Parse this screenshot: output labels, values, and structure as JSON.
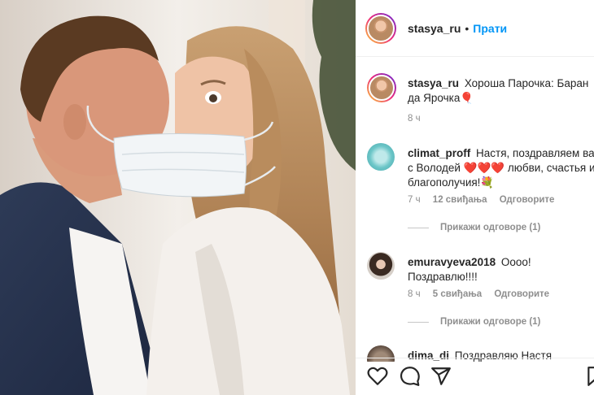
{
  "post": {
    "author": "stasya_ru",
    "dot": "•",
    "follow_label": "Прати",
    "caption_user": "stasya_ru",
    "caption_text": "Хороша Парочка: Баран да Ярочка🎈",
    "caption_time": "8 ч"
  },
  "comments": [
    {
      "user": "climat_proff",
      "text_before": "Настя, поздравляем вас с Володей ",
      "hearts": "❤️❤️❤️",
      "text_after": " любви, счастья и благополучия!💐",
      "time": "7 ч",
      "likes": "12 свиђања",
      "reply": "Одговорите",
      "view_replies": "Прикажи одговоре (1)"
    },
    {
      "user": "emuravyeva2018",
      "text": "Оооо! Поздравлю!!!!",
      "time": "8 ч",
      "likes": "5 свиђања",
      "reply": "Одговорите",
      "view_replies": "Прикажи одговоре (1)"
    },
    {
      "user": "dima_di",
      "text": "Поздравляю Настя"
    }
  ],
  "actions": {
    "icons": [
      "heart-icon",
      "comment-icon",
      "share-icon",
      "save-icon"
    ]
  },
  "colors": {
    "link_blue": "#0095f6",
    "muted_gray": "#8e8e8e",
    "heart_red": "#ed4956"
  }
}
